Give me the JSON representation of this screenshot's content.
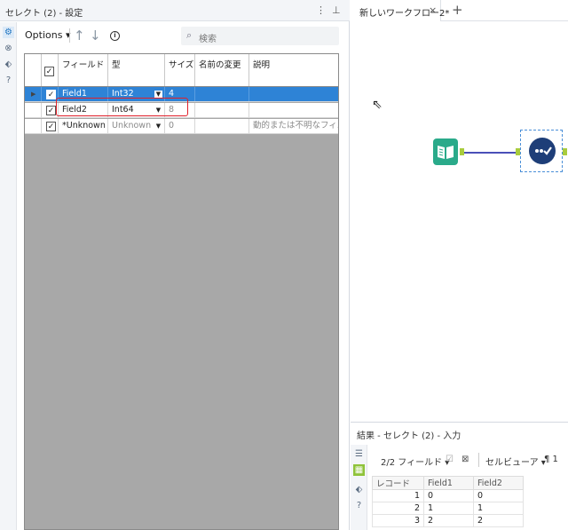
{
  "config": {
    "title": "セレクト (2) - 設定",
    "toolbar": {
      "options_label": "Options ▾",
      "search_placeholder": "検索"
    },
    "columns": [
      "フィールド",
      "型",
      "サイズ",
      "名前の変更",
      "説明"
    ],
    "rows": [
      {
        "checked": true,
        "field": "Field1",
        "type": "Int32",
        "size": "4",
        "rename": "",
        "desc": ""
      },
      {
        "checked": true,
        "field": "Field2",
        "type": "Int64",
        "size": "8",
        "rename": "",
        "desc": ""
      },
      {
        "checked": true,
        "field": "*Unknown",
        "type": "Unknown",
        "size": "0",
        "rename": "",
        "desc": "動的または不明なフィ..."
      }
    ]
  },
  "tabs": {
    "workflow_label": "新しいワークフロー2*"
  },
  "results": {
    "title": "結果 - セレクト (2) - 入力",
    "fields_label": "2/2 フィールド ▾",
    "view_label": "セルビューア ▾",
    "extra_label": "¶ 1",
    "table": {
      "headers": [
        "レコード",
        "Field1",
        "Field2"
      ],
      "rows": [
        [
          "1",
          "0",
          "0"
        ],
        [
          "2",
          "1",
          "1"
        ],
        [
          "3",
          "2",
          "2"
        ]
      ]
    }
  },
  "colors": {
    "selection": "#2e83d6",
    "highlight": "#e0202a",
    "input_tool": "#2aaa8a",
    "select_tool": "#1e3e78",
    "connector": "#4a4fb8"
  }
}
